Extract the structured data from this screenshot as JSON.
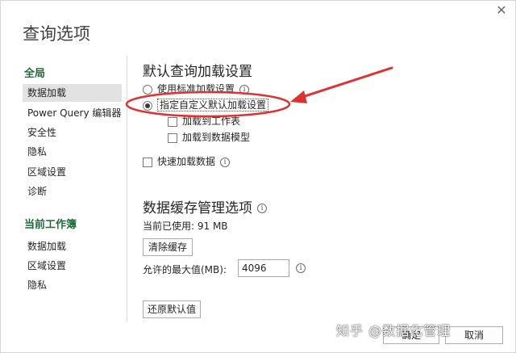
{
  "dialog": {
    "title": "查询选项",
    "close_glyph": "✕"
  },
  "sidebar": {
    "group1": "全局",
    "global_items": [
      "数据加载",
      "Power Query 编辑器",
      "安全性",
      "隐私",
      "区域设置",
      "诊断"
    ],
    "group2": "当前工作簿",
    "workbook_items": [
      "数据加载",
      "区域设置",
      "隐私"
    ],
    "selected": "数据加载"
  },
  "load": {
    "title": "默认查询加载设置",
    "opt_standard": "使用标准加载设置",
    "opt_custom": "指定自定义默认加载设置",
    "opt_custom_selected": true,
    "chk_sheet": "加载到工作表",
    "chk_model": "加载到数据模型",
    "chk_fast": "快速加载数据"
  },
  "cache": {
    "title": "数据缓存管理选项",
    "current_used": "当前已使用: 91 MB",
    "clear_button": "清除缓存",
    "max_label": "允许的最大值(MB):",
    "max_value": "4096"
  },
  "footer": {
    "restore_button": "还原默认值",
    "ok_button": "确定",
    "cancel_button": "取消"
  },
  "watermark": "知乎 @数据化管理",
  "colors": {
    "annotation_red": "#e0312f",
    "group_green": "#1f6b3a",
    "selected_bg": "#e2e2e2"
  }
}
